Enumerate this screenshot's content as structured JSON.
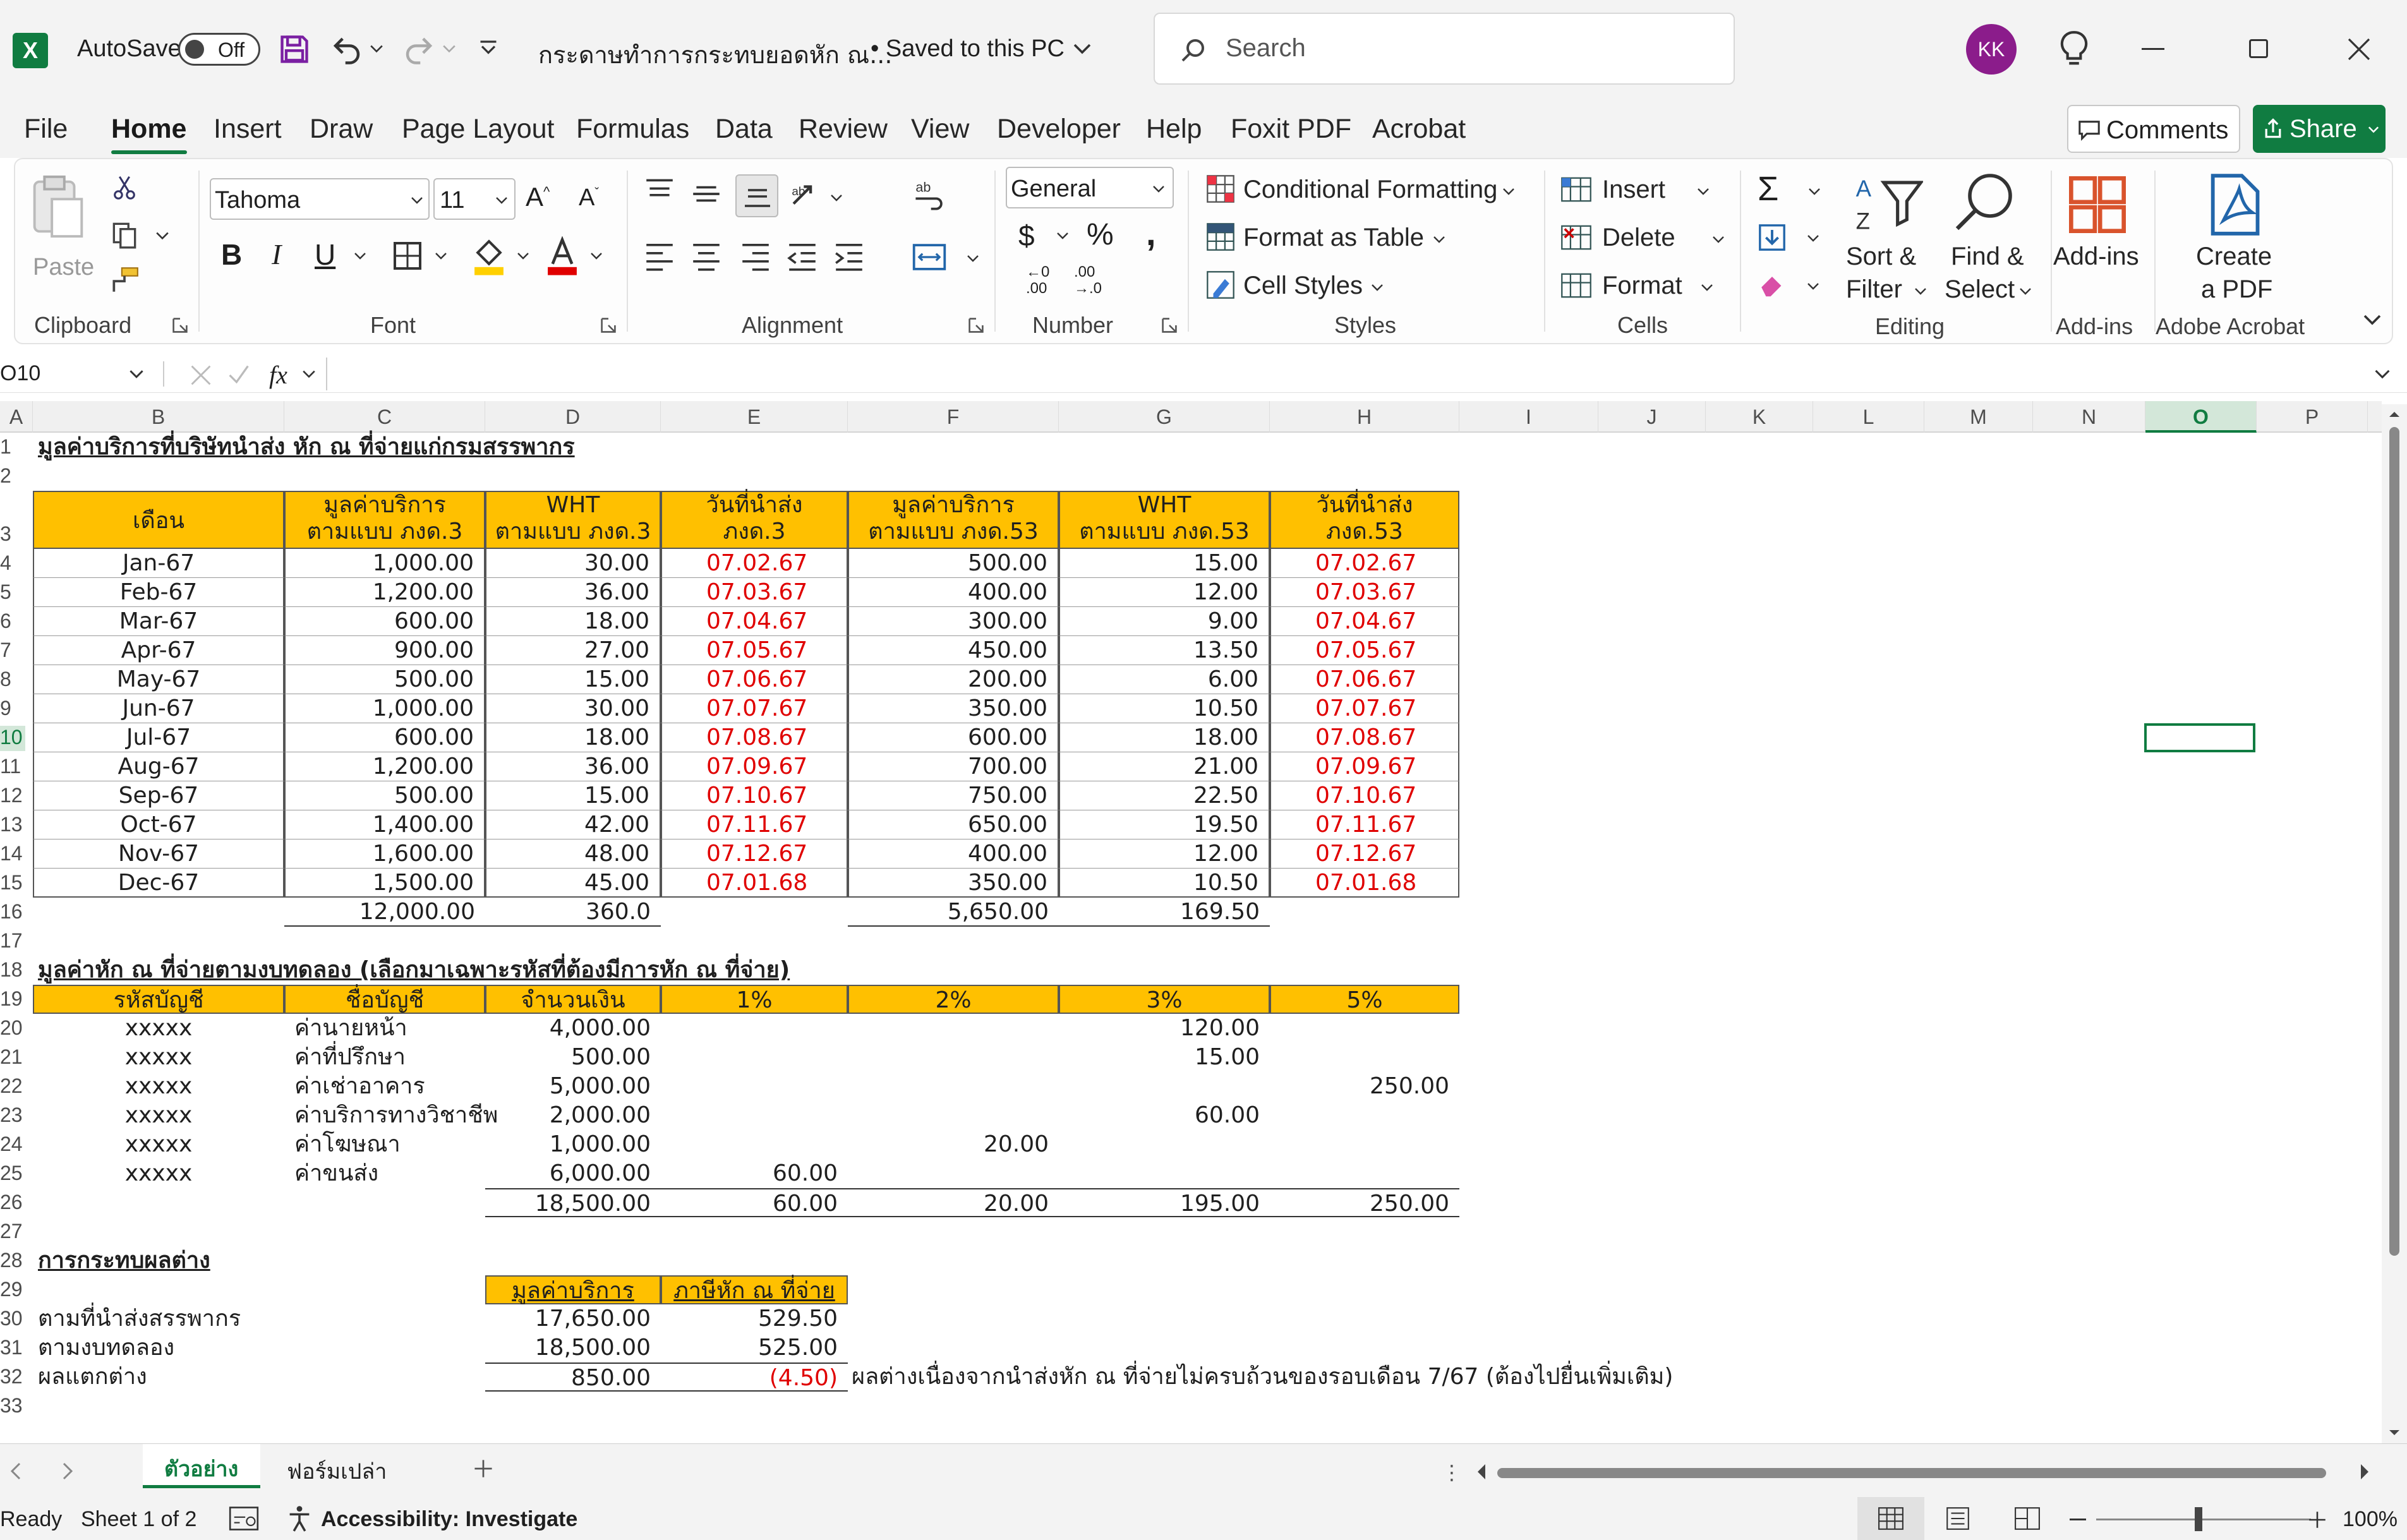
{
  "titlebar": {
    "autosave_label": "AutoSave",
    "autosave_state": "Off",
    "doc_title": "กระดาษทำการกระทบยอดหัก ณ...",
    "save_status": "• Saved to this PC",
    "search_placeholder": "Search",
    "avatar_initials": "KK"
  },
  "menu": {
    "tabs": [
      "File",
      "Home",
      "Insert",
      "Draw",
      "Page Layout",
      "Formulas",
      "Data",
      "Review",
      "View",
      "Developer",
      "Help",
      "Foxit PDF",
      "Acrobat"
    ],
    "comments": "Comments",
    "share": "Share"
  },
  "ribbon": {
    "paste": "Paste",
    "clipboard": "Clipboard",
    "font_name": "Tahoma",
    "font_size": "11",
    "font": "Font",
    "alignment": "Alignment",
    "number_format": "General",
    "number": "Number",
    "cond_fmt": "Conditional Formatting",
    "fmt_table": "Format as Table",
    "cell_styles": "Cell Styles",
    "styles": "Styles",
    "insert": "Insert",
    "delete": "Delete",
    "format": "Format",
    "cells": "Cells",
    "sort1": "Sort &",
    "sort2": "Filter",
    "find1": "Find &",
    "find2": "Select",
    "editing": "Editing",
    "addins": "Add-ins",
    "addins_grp": "Add-ins",
    "create1": "Create",
    "create2": "a PDF",
    "adobe": "Adobe Acrobat"
  },
  "formula_bar": {
    "name_box": "O10",
    "fx": "fx"
  },
  "columns": [
    "A",
    "B",
    "C",
    "D",
    "E",
    "F",
    "G",
    "H",
    "I",
    "J",
    "K",
    "L",
    "M",
    "N",
    "O",
    "P"
  ],
  "rows": [
    "1",
    "2",
    "3",
    "4",
    "5",
    "6",
    "7",
    "8",
    "9",
    "10",
    "11",
    "12",
    "13",
    "14",
    "15",
    "16",
    "17",
    "18",
    "19",
    "20",
    "21",
    "22",
    "23",
    "24",
    "25",
    "26",
    "27",
    "28",
    "29",
    "30",
    "31",
    "32",
    "33"
  ],
  "sheet": {
    "title1": "มูลค่าบริการที่บริษัทนำส่ง หัก ณ ที่จ่ายแก่กรมสรรพากร",
    "hdr": {
      "month": "เดือน",
      "c1a": "มูลค่าบริการ",
      "c1b": "ตามแบบ ภงด.3",
      "c2a": "WHT",
      "c2b": "ตามแบบ ภงด.3",
      "c3a": "วันที่นำส่ง",
      "c3b": "ภงด.3",
      "c4a": "มูลค่าบริการ",
      "c4b": "ตามแบบ ภงด.53",
      "c5a": "WHT",
      "c5b": "ตามแบบ ภงด.53",
      "c6a": "วันที่นำส่ง",
      "c6b": "ภงด.53"
    },
    "months": [
      [
        "Jan-67",
        "1,000.00",
        "30.00",
        "07.02.67",
        "500.00",
        "15.00",
        "07.02.67"
      ],
      [
        "Feb-67",
        "1,200.00",
        "36.00",
        "07.03.67",
        "400.00",
        "12.00",
        "07.03.67"
      ],
      [
        "Mar-67",
        "600.00",
        "18.00",
        "07.04.67",
        "300.00",
        "9.00",
        "07.04.67"
      ],
      [
        "Apr-67",
        "900.00",
        "27.00",
        "07.05.67",
        "450.00",
        "13.50",
        "07.05.67"
      ],
      [
        "May-67",
        "500.00",
        "15.00",
        "07.06.67",
        "200.00",
        "6.00",
        "07.06.67"
      ],
      [
        "Jun-67",
        "1,000.00",
        "30.00",
        "07.07.67",
        "350.00",
        "10.50",
        "07.07.67"
      ],
      [
        "Jul-67",
        "600.00",
        "18.00",
        "07.08.67",
        "600.00",
        "18.00",
        "07.08.67"
      ],
      [
        "Aug-67",
        "1,200.00",
        "36.00",
        "07.09.67",
        "700.00",
        "21.00",
        "07.09.67"
      ],
      [
        "Sep-67",
        "500.00",
        "15.00",
        "07.10.67",
        "750.00",
        "22.50",
        "07.10.67"
      ],
      [
        "Oct-67",
        "1,400.00",
        "42.00",
        "07.11.67",
        "650.00",
        "19.50",
        "07.11.67"
      ],
      [
        "Nov-67",
        "1,600.00",
        "48.00",
        "07.12.67",
        "400.00",
        "12.00",
        "07.12.67"
      ],
      [
        "Dec-67",
        "1,500.00",
        "45.00",
        "07.01.68",
        "350.00",
        "10.50",
        "07.01.68"
      ]
    ],
    "totals1": [
      "12,000.00",
      "360.0",
      "5,650.00",
      "169.50"
    ],
    "title2": "มูลค่าหัก ณ ที่จ่ายตามงบทดลอง (เลือกมาเฉพาะรหัสที่ต้องมีการหัก ณ ที่จ่าย)",
    "hdr2": [
      "รหัสบัญชี",
      "ชื่อบัญชี",
      "จำนวนเงิน",
      "1%",
      "2%",
      "3%",
      "5%"
    ],
    "accounts": [
      [
        "xxxxx",
        "ค่านายหน้า",
        "4,000.00",
        "",
        "",
        "120.00",
        ""
      ],
      [
        "xxxxx",
        "ค่าที่ปรึกษา",
        "500.00",
        "",
        "",
        "15.00",
        ""
      ],
      [
        "xxxxx",
        "ค่าเช่าอาคาร",
        "5,000.00",
        "",
        "",
        "",
        "250.00"
      ],
      [
        "xxxxx",
        "ค่าบริการทางวิชาชีพ",
        "2,000.00",
        "",
        "",
        "60.00",
        ""
      ],
      [
        "xxxxx",
        "ค่าโฆษณา",
        "1,000.00",
        "",
        "20.00",
        "",
        ""
      ],
      [
        "xxxxx",
        "ค่าขนส่ง",
        "6,000.00",
        "60.00",
        "",
        "",
        ""
      ]
    ],
    "totals2": [
      "18,500.00",
      "60.00",
      "20.00",
      "195.00",
      "250.00"
    ],
    "title3": "การกระทบผลต่าง",
    "hdr3": [
      "มูลค่าบริการ",
      "ภาษีหัก ณ ที่จ่าย"
    ],
    "recon": [
      [
        "ตามที่นำส่งสรรพากร",
        "17,650.00",
        "529.50"
      ],
      [
        "ตามงบทดลอง",
        "18,500.00",
        "525.00"
      ],
      [
        "ผลแตกต่าง",
        "850.00",
        "(4.50)"
      ]
    ],
    "note": "ผลต่างเนื่องจากนำส่งหัก ณ ที่จ่ายไม่ครบถ้วนของรอบเดือน 7/67 (ต้องไปยื่นเพิ่มเติม)"
  },
  "sheet_tabs": [
    "ตัวอย่าง",
    "ฟอร์มเปล่า"
  ],
  "status": {
    "ready": "Ready",
    "sheet_of": "Sheet 1 of 2",
    "accessibility": "Accessibility: Investigate",
    "zoom": "100%"
  }
}
